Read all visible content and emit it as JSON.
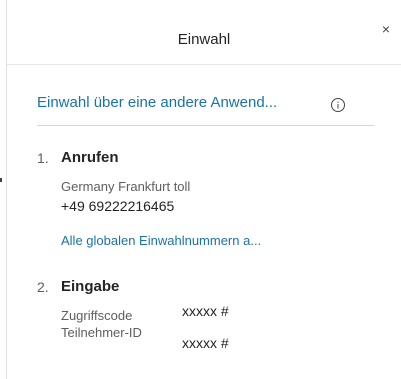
{
  "header": {
    "title": "Einwahl",
    "close_label": "×"
  },
  "dial_in_other_app": {
    "label": "Einwahl über eine andere Anwend...",
    "info_icon": "info-icon"
  },
  "steps": [
    {
      "number": "1.",
      "title": "Anrufen",
      "location": "Germany Frankfurt toll",
      "phone": "+49 69222216465",
      "all_numbers_link": "Alle globalen Einwahlnummern a..."
    },
    {
      "number": "2.",
      "title": "Eingabe",
      "fields": [
        {
          "label": "Zugriffscode",
          "value": "xxxxx #"
        },
        {
          "label": "Teilnehmer-ID",
          "value": "xxxxx #"
        }
      ]
    }
  ],
  "colors": {
    "link": "#1a73a8",
    "text": "#252423",
    "muted": "#605e5c"
  }
}
